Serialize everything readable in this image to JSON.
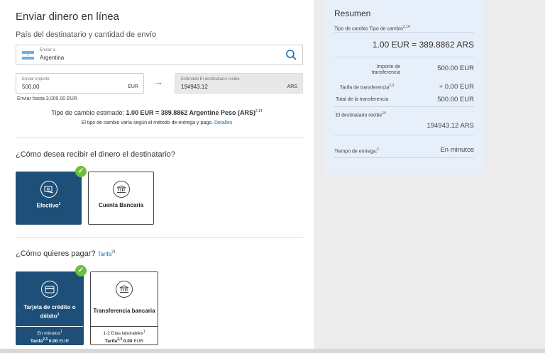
{
  "form": {
    "title": "Enviar dinero en línea",
    "subtitle": "País del destinatario y cantidad de envío",
    "country": {
      "label": "Enviar a",
      "value": "Argentina"
    },
    "send": {
      "label": "Enviar importe",
      "value": "500.00",
      "currency": "EUR"
    },
    "receive": {
      "label": "Estimado El destinatario recibe",
      "value": "194943.12",
      "currency": "ARS"
    },
    "send_limit": "Enviar hasta 3,000.00 EUR",
    "rate_prefix": "Tipo de cambio estimado: ",
    "rate_bold": "1.00 EUR = 389.8862 Argentine Peso (ARS)",
    "rate_sup": "2,14",
    "rate_note": "El tipo de cambio varía según el método de entrega y pago.",
    "rate_link": "Detalles"
  },
  "receive_method": {
    "question": "¿Cómo desea recibir el dinero el destinatario?",
    "options": [
      {
        "label": "Efectivo",
        "sup": "1",
        "selected": true
      },
      {
        "label": "Cuenta Bancaria",
        "sup": "",
        "selected": false
      }
    ]
  },
  "payment": {
    "question": "¿Cómo quieres pagar?",
    "link": "Tarifa",
    "link_sup": "31",
    "options": [
      {
        "label": "Tarjeta de crédito o débito",
        "sup": "3",
        "time": "En minutos",
        "time_sup": "1",
        "fee_label": "Tarifa",
        "fee_sup": "2,3",
        "fee": "0.00",
        "fee_currency": "EUR",
        "selected": true
      },
      {
        "label": "Transferencia bancaria",
        "sup": "",
        "time": "1-2 Días laborables",
        "time_sup": "1",
        "fee_label": "Tarifa",
        "fee_sup": "2,3",
        "fee": "0.00",
        "fee_currency": "EUR",
        "selected": false
      }
    ]
  },
  "summary": {
    "title": "Resumen",
    "rate_label": "Tipo de cambio Tipo de cambio",
    "rate_sup": "2,14",
    "rate_value": "1.00 EUR = 389.8862 ARS",
    "transfer_amount_label_1": "Importe de",
    "transfer_amount_label_2": "transferencia",
    "transfer_amount": "500.00 EUR",
    "fee_label": "Tarifa de transferencia",
    "fee_sup": "2,3",
    "fee": "+ 0.00 EUR",
    "total_label": "Total de la transferencia",
    "total": "500.00 EUR",
    "recipient_label": "El destinatario recibe",
    "recipient_sup": "14",
    "recipient_value": "194943.12 ARS",
    "delivery_label": "Tiempo de entrega:",
    "delivery_sup": "1",
    "delivery_value": "En minutos"
  },
  "colors": {
    "selected": "#1e4f78",
    "check": "#6cbf3c",
    "summary_bg": "#e7f0fa",
    "link": "#1a6fb0"
  },
  "icons": [
    "argentina-flag-icon",
    "search-icon",
    "arrow-right-icon",
    "cash-icon",
    "bank-icon",
    "credit-card-icon",
    "checkmark-icon"
  ]
}
